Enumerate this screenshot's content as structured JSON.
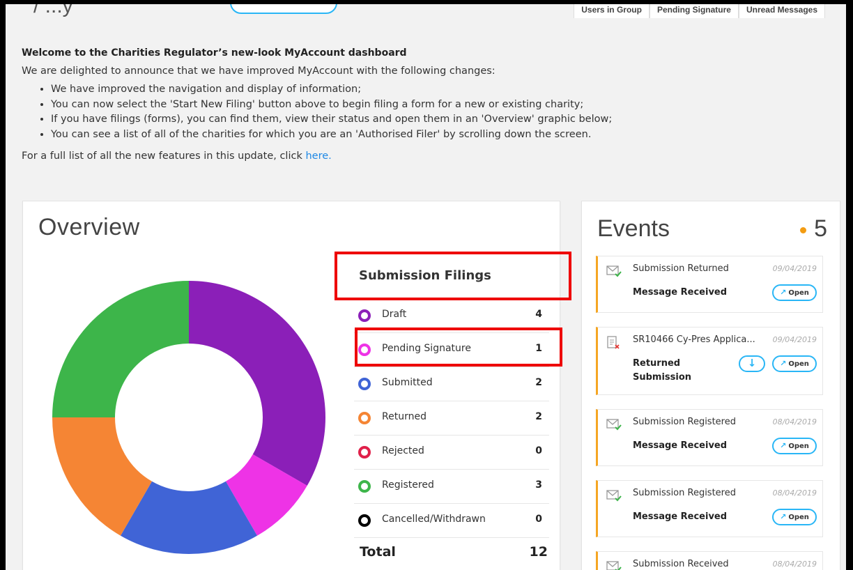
{
  "header": {
    "title_fragment": "/ ...y",
    "tabs": [
      "Users in Group",
      "Pending Signature",
      "Unread Messages"
    ]
  },
  "welcome": {
    "heading": "Welcome to the Charities Regulator’s new-look MyAccount dashboard",
    "intro": "We are delighted to announce that we have improved MyAccount with the following changes:",
    "bullets": [
      "We have improved the navigation and display of information;",
      "You can now select the 'Start New Filing' button above to begin filing a form for a new or existing charity;",
      "If you have filings (forms), you can find them, view their status and open them in an 'Overview' graphic below;",
      "You can see a list of all of the charities for which you are an 'Authorised Filer' by scrolling down the screen."
    ],
    "footer_text": "For a full list of all the new features in this update, click ",
    "footer_link": "here."
  },
  "overview": {
    "title": "Overview",
    "legend_title": "Submission Filings",
    "total_label": "Total",
    "total_value": "12"
  },
  "chart_data": {
    "type": "pie",
    "categories": [
      "Draft",
      "Pending Signature",
      "Submitted",
      "Returned",
      "Rejected",
      "Registered",
      "Cancelled/Withdrawn"
    ],
    "values": [
      4,
      1,
      2,
      2,
      0,
      3,
      0
    ],
    "colors": [
      "#8b1fb8",
      "#ee33e6",
      "#4064d6",
      "#f58534",
      "#e0204a",
      "#3db54a",
      "#000000"
    ],
    "title": "",
    "donut": true
  },
  "events": {
    "title": "Events",
    "count": "5",
    "items": [
      {
        "subject": "Submission Returned",
        "date": "09/04/2019",
        "type": "Message Received",
        "icon": "mail-check-icon"
      },
      {
        "subject": "SR10466 Cy-Pres Applica...",
        "date": "09/04/2019",
        "type": "Returned Submission",
        "icon": "document-error-icon"
      },
      {
        "subject": "Submission Registered",
        "date": "08/04/2019",
        "type": "Message Received",
        "icon": "mail-check-icon"
      },
      {
        "subject": "Submission Registered",
        "date": "08/04/2019",
        "type": "Message Received",
        "icon": "mail-check-icon"
      },
      {
        "subject": "Submission Received",
        "date": "08/04/2019",
        "type": "",
        "icon": "mail-check-icon"
      }
    ],
    "open_label": "Open"
  }
}
